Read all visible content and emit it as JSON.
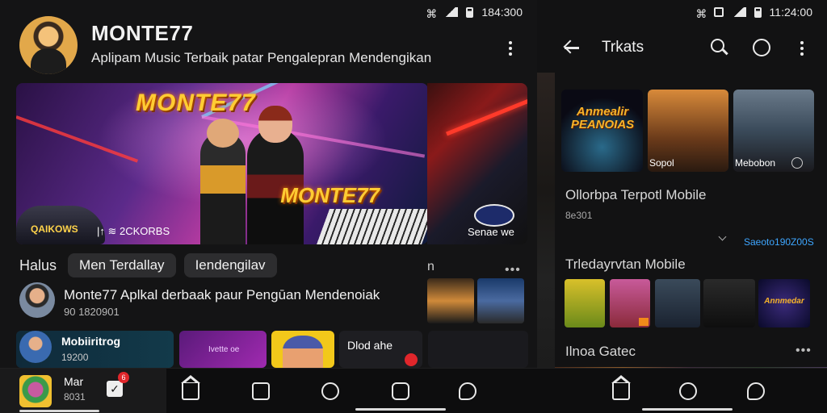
{
  "left_screen": {
    "status_bar": {
      "time": "184:300"
    },
    "channel": {
      "name": "MONTE77",
      "subtitle": "Aplipam Music Terbaik patar Pengalepran Mendengikan"
    },
    "hero": {
      "logo_text": "MONTE77",
      "logo_text_2": "MONTE77",
      "caption_left": "QAIKOWS",
      "caption_mid": "|↑ ≋ 2CKORBS",
      "peek_caption": "Senae we"
    },
    "chips": {
      "label": "Halus",
      "items": [
        "Men Terdallay",
        "Iendengilav"
      ]
    },
    "list_item": {
      "title": "Monte77 Aplkal derbaak paur Pengūan Mendenoiak",
      "subtitle": "90 1820901"
    },
    "shelf": {
      "card_a_title": "Mobiiritrog",
      "card_a_sub": "19200",
      "card_b_text": "Ivette oe",
      "card_d_text": "Dlod ahe"
    },
    "mini_player": {
      "title": "Mar",
      "subtitle": "8031",
      "badge_count": "6",
      "progress": 0.55
    }
  },
  "right_screen": {
    "status_bar": {
      "time": "11:24:00"
    },
    "header": {
      "title": "Trkats"
    },
    "posters": [
      {
        "title": "Anmealir PEANOIAS",
        "label": ""
      },
      {
        "title": "",
        "label": "Sopol"
      },
      {
        "title": "",
        "label": "Mebobon"
      }
    ],
    "section_1": {
      "title": "Ollorbpa Terpotl Mobile",
      "subtitle": "8e301",
      "link": "Saeoto190Z00S"
    },
    "section_2": {
      "title": "Trledayrvtan Mobile",
      "games": [
        {
          "title": ""
        },
        {
          "title": ""
        },
        {
          "title": ""
        },
        {
          "title": ""
        },
        {
          "title": "Annmedar"
        }
      ]
    },
    "section_3": {
      "title": "Ilnoa Gatec"
    }
  },
  "colors": {
    "background": "#141415",
    "accent_link": "#3ea6ff",
    "badge_red": "#e0262b",
    "logo_gold": "#ffcc33"
  },
  "icons": [
    "back-arrow-icon",
    "search-icon",
    "cast-icon",
    "kebab-icon",
    "home-icon",
    "library-icon",
    "explore-icon",
    "shorts-icon",
    "chat-icon"
  ]
}
